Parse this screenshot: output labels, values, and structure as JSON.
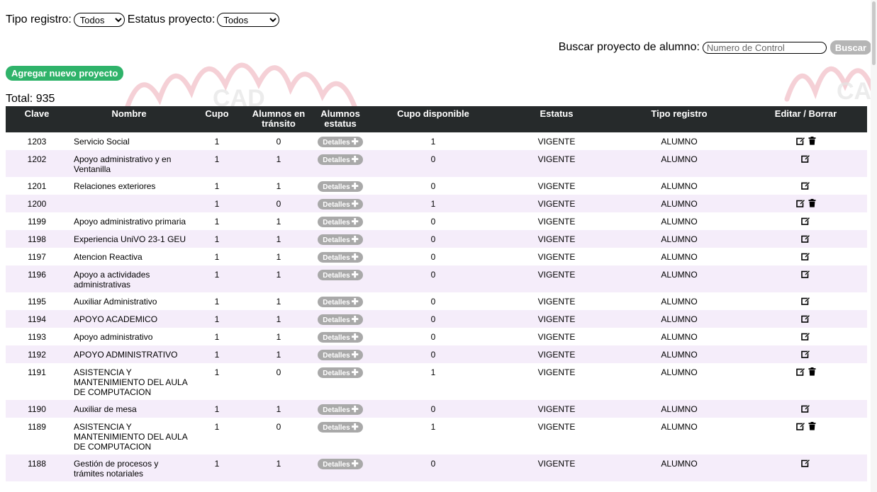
{
  "filters": {
    "tipo_label": "Tipo registro:",
    "tipo_value": "Todos",
    "estatus_label": "Estatus proyecto:",
    "estatus_value": "Todos"
  },
  "search": {
    "label": "Buscar proyecto de alumno:",
    "placeholder": "Numero de Control",
    "button": "Buscar"
  },
  "add_button": "Agregar nuevo proyecto",
  "total": "Total: 935",
  "colors": {
    "header_bg": "#262a2b",
    "add_button": "#2fb36a",
    "row_alt": "#f4ecfa",
    "detail_button": "#a9a9a9"
  },
  "table": {
    "headers": [
      "Clave",
      "Nombre",
      "Cupo",
      "Alumnos en tránsito",
      "Alumnos estatus",
      "Cupo disponible",
      "Estatus",
      "Tipo registro",
      "Editar / Borrar"
    ],
    "detail_label": "Detalles",
    "rows": [
      {
        "clave": "1203",
        "nombre": "Servicio Social",
        "cupo": "1",
        "transito": "0",
        "disponible": "1",
        "estatus": "VIGENTE",
        "tipo": "ALUMNO",
        "delete": true
      },
      {
        "clave": "1202",
        "nombre": "Apoyo administrativo y en Ventanilla",
        "cupo": "1",
        "transito": "1",
        "disponible": "0",
        "estatus": "VIGENTE",
        "tipo": "ALUMNO",
        "delete": false
      },
      {
        "clave": "1201",
        "nombre": "Relaciones exteriores",
        "cupo": "1",
        "transito": "1",
        "disponible": "0",
        "estatus": "VIGENTE",
        "tipo": "ALUMNO",
        "delete": false
      },
      {
        "clave": "1200",
        "nombre": "",
        "cupo": "1",
        "transito": "0",
        "disponible": "1",
        "estatus": "VIGENTE",
        "tipo": "ALUMNO",
        "delete": true
      },
      {
        "clave": "1199",
        "nombre": "Apoyo administrativo primaria",
        "cupo": "1",
        "transito": "1",
        "disponible": "0",
        "estatus": "VIGENTE",
        "tipo": "ALUMNO",
        "delete": false
      },
      {
        "clave": "1198",
        "nombre": "Experiencia UniVO 23-1 GEU",
        "cupo": "1",
        "transito": "1",
        "disponible": "0",
        "estatus": "VIGENTE",
        "tipo": "ALUMNO",
        "delete": false
      },
      {
        "clave": "1197",
        "nombre": "Atencion Reactiva",
        "cupo": "1",
        "transito": "1",
        "disponible": "0",
        "estatus": "VIGENTE",
        "tipo": "ALUMNO",
        "delete": false
      },
      {
        "clave": "1196",
        "nombre": "Apoyo a actividades administrativas",
        "cupo": "1",
        "transito": "1",
        "disponible": "0",
        "estatus": "VIGENTE",
        "tipo": "ALUMNO",
        "delete": false
      },
      {
        "clave": "1195",
        "nombre": "Auxiliar Administrativo",
        "cupo": "1",
        "transito": "1",
        "disponible": "0",
        "estatus": "VIGENTE",
        "tipo": "ALUMNO",
        "delete": false
      },
      {
        "clave": "1194",
        "nombre": "APOYO ACADEMICO",
        "cupo": "1",
        "transito": "1",
        "disponible": "0",
        "estatus": "VIGENTE",
        "tipo": "ALUMNO",
        "delete": false
      },
      {
        "clave": "1193",
        "nombre": "Apoyo administrativo",
        "cupo": "1",
        "transito": "1",
        "disponible": "0",
        "estatus": "VIGENTE",
        "tipo": "ALUMNO",
        "delete": false
      },
      {
        "clave": "1192",
        "nombre": "APOYO ADMINISTRATIVO",
        "cupo": "1",
        "transito": "1",
        "disponible": "0",
        "estatus": "VIGENTE",
        "tipo": "ALUMNO",
        "delete": false
      },
      {
        "clave": "1191",
        "nombre": "ASISTENCIA Y MANTENIMIENTO DEL AULA DE COMPUTACION",
        "cupo": "1",
        "transito": "0",
        "disponible": "1",
        "estatus": "VIGENTE",
        "tipo": "ALUMNO",
        "delete": true
      },
      {
        "clave": "1190",
        "nombre": "Auxiliar de mesa",
        "cupo": "1",
        "transito": "1",
        "disponible": "0",
        "estatus": "VIGENTE",
        "tipo": "ALUMNO",
        "delete": false
      },
      {
        "clave": "1189",
        "nombre": "ASISTENCIA Y MANTENIMIENTO DEL AULA DE COMPUTACION",
        "cupo": "1",
        "transito": "0",
        "disponible": "1",
        "estatus": "VIGENTE",
        "tipo": "ALUMNO",
        "delete": true
      },
      {
        "clave": "1188",
        "nombre": "Gestión de procesos y trámites notariales",
        "cupo": "1",
        "transito": "1",
        "disponible": "0",
        "estatus": "VIGENTE",
        "tipo": "ALUMNO",
        "delete": false
      }
    ]
  }
}
